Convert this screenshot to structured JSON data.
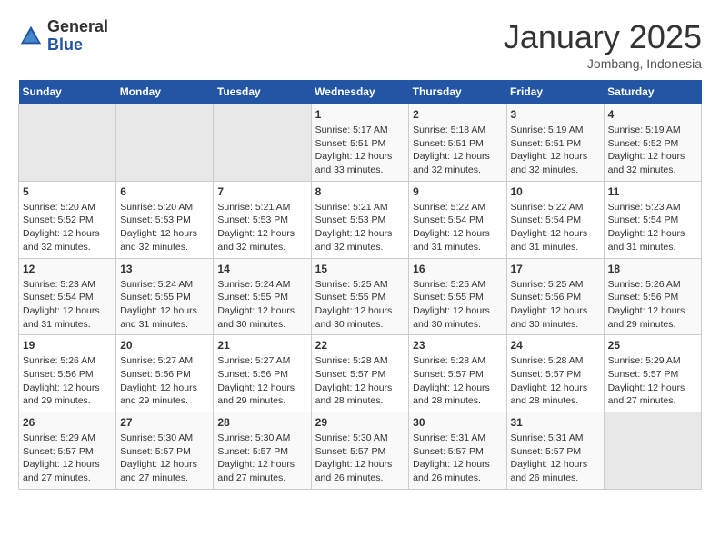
{
  "header": {
    "logo_general": "General",
    "logo_blue": "Blue",
    "month": "January 2025",
    "location": "Jombang, Indonesia"
  },
  "weekdays": [
    "Sunday",
    "Monday",
    "Tuesday",
    "Wednesday",
    "Thursday",
    "Friday",
    "Saturday"
  ],
  "weeks": [
    [
      {
        "day": "",
        "sunrise": "",
        "sunset": "",
        "daylight": ""
      },
      {
        "day": "",
        "sunrise": "",
        "sunset": "",
        "daylight": ""
      },
      {
        "day": "",
        "sunrise": "",
        "sunset": "",
        "daylight": ""
      },
      {
        "day": "1",
        "sunrise": "Sunrise: 5:17 AM",
        "sunset": "Sunset: 5:51 PM",
        "daylight": "Daylight: 12 hours and 33 minutes."
      },
      {
        "day": "2",
        "sunrise": "Sunrise: 5:18 AM",
        "sunset": "Sunset: 5:51 PM",
        "daylight": "Daylight: 12 hours and 32 minutes."
      },
      {
        "day": "3",
        "sunrise": "Sunrise: 5:19 AM",
        "sunset": "Sunset: 5:51 PM",
        "daylight": "Daylight: 12 hours and 32 minutes."
      },
      {
        "day": "4",
        "sunrise": "Sunrise: 5:19 AM",
        "sunset": "Sunset: 5:52 PM",
        "daylight": "Daylight: 12 hours and 32 minutes."
      }
    ],
    [
      {
        "day": "5",
        "sunrise": "Sunrise: 5:20 AM",
        "sunset": "Sunset: 5:52 PM",
        "daylight": "Daylight: 12 hours and 32 minutes."
      },
      {
        "day": "6",
        "sunrise": "Sunrise: 5:20 AM",
        "sunset": "Sunset: 5:53 PM",
        "daylight": "Daylight: 12 hours and 32 minutes."
      },
      {
        "day": "7",
        "sunrise": "Sunrise: 5:21 AM",
        "sunset": "Sunset: 5:53 PM",
        "daylight": "Daylight: 12 hours and 32 minutes."
      },
      {
        "day": "8",
        "sunrise": "Sunrise: 5:21 AM",
        "sunset": "Sunset: 5:53 PM",
        "daylight": "Daylight: 12 hours and 32 minutes."
      },
      {
        "day": "9",
        "sunrise": "Sunrise: 5:22 AM",
        "sunset": "Sunset: 5:54 PM",
        "daylight": "Daylight: 12 hours and 31 minutes."
      },
      {
        "day": "10",
        "sunrise": "Sunrise: 5:22 AM",
        "sunset": "Sunset: 5:54 PM",
        "daylight": "Daylight: 12 hours and 31 minutes."
      },
      {
        "day": "11",
        "sunrise": "Sunrise: 5:23 AM",
        "sunset": "Sunset: 5:54 PM",
        "daylight": "Daylight: 12 hours and 31 minutes."
      }
    ],
    [
      {
        "day": "12",
        "sunrise": "Sunrise: 5:23 AM",
        "sunset": "Sunset: 5:54 PM",
        "daylight": "Daylight: 12 hours and 31 minutes."
      },
      {
        "day": "13",
        "sunrise": "Sunrise: 5:24 AM",
        "sunset": "Sunset: 5:55 PM",
        "daylight": "Daylight: 12 hours and 31 minutes."
      },
      {
        "day": "14",
        "sunrise": "Sunrise: 5:24 AM",
        "sunset": "Sunset: 5:55 PM",
        "daylight": "Daylight: 12 hours and 30 minutes."
      },
      {
        "day": "15",
        "sunrise": "Sunrise: 5:25 AM",
        "sunset": "Sunset: 5:55 PM",
        "daylight": "Daylight: 12 hours and 30 minutes."
      },
      {
        "day": "16",
        "sunrise": "Sunrise: 5:25 AM",
        "sunset": "Sunset: 5:55 PM",
        "daylight": "Daylight: 12 hours and 30 minutes."
      },
      {
        "day": "17",
        "sunrise": "Sunrise: 5:25 AM",
        "sunset": "Sunset: 5:56 PM",
        "daylight": "Daylight: 12 hours and 30 minutes."
      },
      {
        "day": "18",
        "sunrise": "Sunrise: 5:26 AM",
        "sunset": "Sunset: 5:56 PM",
        "daylight": "Daylight: 12 hours and 29 minutes."
      }
    ],
    [
      {
        "day": "19",
        "sunrise": "Sunrise: 5:26 AM",
        "sunset": "Sunset: 5:56 PM",
        "daylight": "Daylight: 12 hours and 29 minutes."
      },
      {
        "day": "20",
        "sunrise": "Sunrise: 5:27 AM",
        "sunset": "Sunset: 5:56 PM",
        "daylight": "Daylight: 12 hours and 29 minutes."
      },
      {
        "day": "21",
        "sunrise": "Sunrise: 5:27 AM",
        "sunset": "Sunset: 5:56 PM",
        "daylight": "Daylight: 12 hours and 29 minutes."
      },
      {
        "day": "22",
        "sunrise": "Sunrise: 5:28 AM",
        "sunset": "Sunset: 5:57 PM",
        "daylight": "Daylight: 12 hours and 28 minutes."
      },
      {
        "day": "23",
        "sunrise": "Sunrise: 5:28 AM",
        "sunset": "Sunset: 5:57 PM",
        "daylight": "Daylight: 12 hours and 28 minutes."
      },
      {
        "day": "24",
        "sunrise": "Sunrise: 5:28 AM",
        "sunset": "Sunset: 5:57 PM",
        "daylight": "Daylight: 12 hours and 28 minutes."
      },
      {
        "day": "25",
        "sunrise": "Sunrise: 5:29 AM",
        "sunset": "Sunset: 5:57 PM",
        "daylight": "Daylight: 12 hours and 27 minutes."
      }
    ],
    [
      {
        "day": "26",
        "sunrise": "Sunrise: 5:29 AM",
        "sunset": "Sunset: 5:57 PM",
        "daylight": "Daylight: 12 hours and 27 minutes."
      },
      {
        "day": "27",
        "sunrise": "Sunrise: 5:30 AM",
        "sunset": "Sunset: 5:57 PM",
        "daylight": "Daylight: 12 hours and 27 minutes."
      },
      {
        "day": "28",
        "sunrise": "Sunrise: 5:30 AM",
        "sunset": "Sunset: 5:57 PM",
        "daylight": "Daylight: 12 hours and 27 minutes."
      },
      {
        "day": "29",
        "sunrise": "Sunrise: 5:30 AM",
        "sunset": "Sunset: 5:57 PM",
        "daylight": "Daylight: 12 hours and 26 minutes."
      },
      {
        "day": "30",
        "sunrise": "Sunrise: 5:31 AM",
        "sunset": "Sunset: 5:57 PM",
        "daylight": "Daylight: 12 hours and 26 minutes."
      },
      {
        "day": "31",
        "sunrise": "Sunrise: 5:31 AM",
        "sunset": "Sunset: 5:57 PM",
        "daylight": "Daylight: 12 hours and 26 minutes."
      },
      {
        "day": "",
        "sunrise": "",
        "sunset": "",
        "daylight": ""
      }
    ]
  ]
}
